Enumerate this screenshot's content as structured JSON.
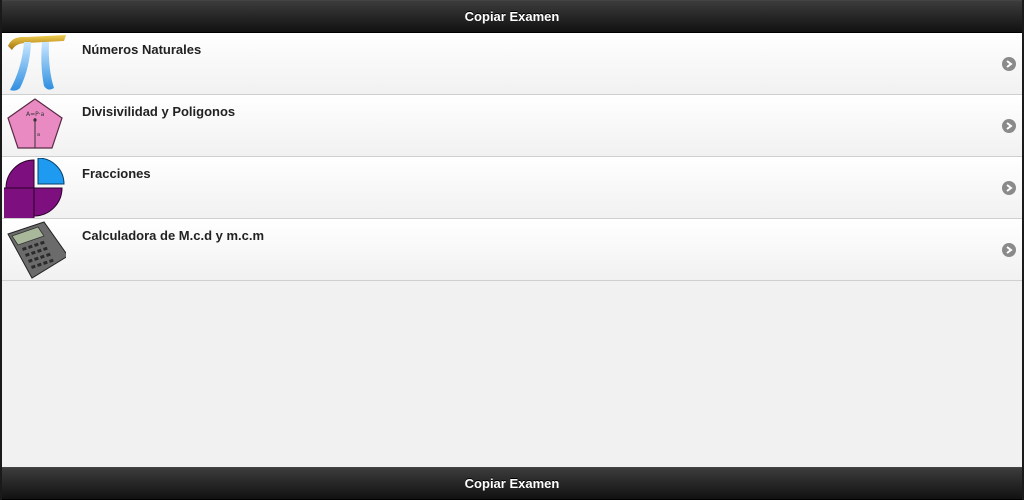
{
  "header": {
    "title": "Copiar Examen"
  },
  "footer": {
    "title": "Copiar Examen"
  },
  "list": {
    "items": [
      {
        "label": "Números Naturales",
        "icon": "pi-icon"
      },
      {
        "label": "Divisivilidad y Poligonos",
        "icon": "pentagon-icon"
      },
      {
        "label": "Fracciones",
        "icon": "pie-fraction-icon"
      },
      {
        "label": "Calculadora de M.c.d y m.c.m",
        "icon": "calculator-icon"
      }
    ]
  },
  "colors": {
    "bar": "#1a1a1a",
    "pi_gold": "#c9971a",
    "pentagon": "#e98ac3",
    "pie_purple": "#7e0f7e",
    "pie_blue": "#1e9af0",
    "arrow": "#8a8a8a"
  }
}
